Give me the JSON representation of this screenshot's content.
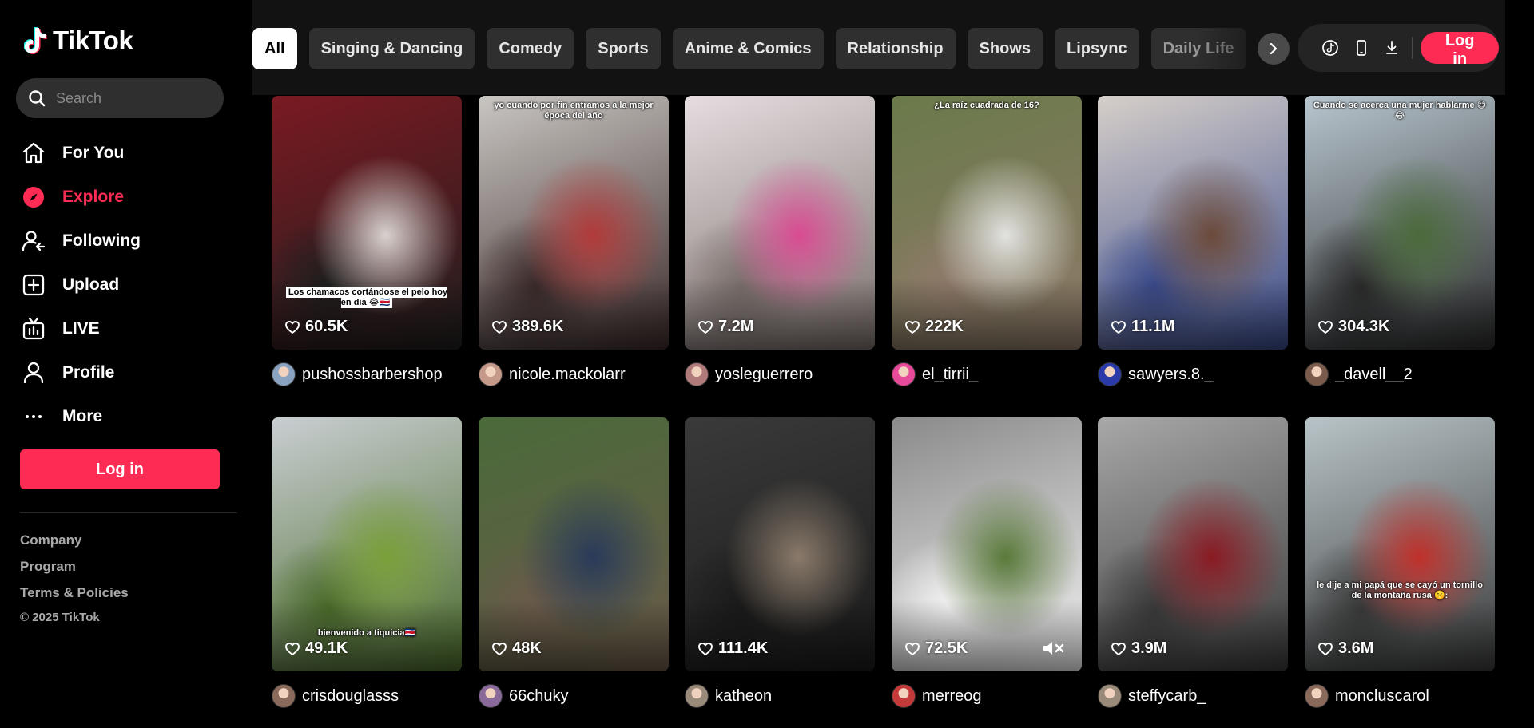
{
  "brand": {
    "name": "TikTok",
    "accent": "#fe2c55"
  },
  "search": {
    "placeholder": "Search"
  },
  "nav": [
    {
      "label": "For You",
      "icon": "home-icon",
      "active": false
    },
    {
      "label": "Explore",
      "icon": "compass-icon",
      "active": true
    },
    {
      "label": "Following",
      "icon": "following-icon",
      "active": false
    },
    {
      "label": "Upload",
      "icon": "upload-icon",
      "active": false
    },
    {
      "label": "LIVE",
      "icon": "live-tv-icon",
      "active": false
    },
    {
      "label": "Profile",
      "icon": "profile-icon",
      "active": false
    },
    {
      "label": "More",
      "icon": "more-dots-icon",
      "active": false
    }
  ],
  "sidebar_login": "Log in",
  "footer": {
    "links": [
      "Company",
      "Program",
      "Terms & Policies"
    ],
    "copyright": "© 2025 TikTok"
  },
  "categories": [
    {
      "label": "All",
      "active": true
    },
    {
      "label": "Singing & Dancing"
    },
    {
      "label": "Comedy"
    },
    {
      "label": "Sports"
    },
    {
      "label": "Anime & Comics"
    },
    {
      "label": "Relationship"
    },
    {
      "label": "Shows"
    },
    {
      "label": "Lipsync"
    },
    {
      "label": "Daily Life"
    }
  ],
  "topbar": {
    "icons": [
      "tiktok-coin-icon",
      "mobile-app-icon",
      "download-icon"
    ],
    "login": "Log in"
  },
  "videos": [
    {
      "likes": "60.5K",
      "author": "pushossbarbershop",
      "overlay": "Los chamacos cortándose el pelo hoy en día 😂🇨🇷",
      "overlay_style": "boxed",
      "overlay_pos": "bottom",
      "colors": [
        "#7a1a22",
        "#d8d2cf",
        "#1e1e1e"
      ],
      "avatar": "#8aa3c0"
    },
    {
      "likes": "389.6K",
      "author": "nicole.mackolarr",
      "overlay": "yo cuando por fin entramos a la mejor época del año",
      "overlay_style": "plain",
      "overlay_pos": "top",
      "colors": [
        "#c9c6c2",
        "#b23a3a",
        "#3b2a2a"
      ],
      "avatar": "#c69a8a"
    },
    {
      "likes": "7.2M",
      "author": "yosleguerrero",
      "overlay": "",
      "colors": [
        "#e5dde0",
        "#d94b92",
        "#7a6f6b"
      ],
      "avatar": "#b07a7a"
    },
    {
      "likes": "222K",
      "author": "el_tirrii_",
      "overlay": "¿La raíz cuadrada de 16?",
      "overlay_style": "plain",
      "overlay_pos": "top",
      "colors": [
        "#6a7a4a",
        "#e2e2e0",
        "#8f7a6a"
      ],
      "avatar": "#e84a9a"
    },
    {
      "likes": "11.1M",
      "author": "sawyers.8._",
      "overlay": "",
      "colors": [
        "#d6cfc9",
        "#6b4a3a",
        "#3a4a8a"
      ],
      "avatar": "#2a3aa8"
    },
    {
      "likes": "304.3K",
      "author": "_davell__2",
      "overlay": "Cuando se acerca una mujer hablarme 😅😂",
      "overlay_style": "plain",
      "overlay_pos": "top",
      "colors": [
        "#b8c6cf",
        "#4a6a3a",
        "#2a2a2a"
      ],
      "avatar": "#7a5a4a"
    },
    {
      "likes": "49.1K",
      "author": "crisdouglasss",
      "overlay": "bienvenido a tiquicia🇨🇷",
      "overlay_style": "plain",
      "overlay_pos": "bottom",
      "colors": [
        "#c9ced2",
        "#7aa03a",
        "#4a6a2a"
      ],
      "avatar": "#8a6a5a"
    },
    {
      "likes": "48K",
      "author": "66chuky",
      "overlay": "",
      "colors": [
        "#4a6a3a",
        "#2a3a5a",
        "#6a5a4a"
      ],
      "avatar": "#8a6a9a"
    },
    {
      "likes": "111.4K",
      "author": "katheon",
      "overlay": "",
      "colors": [
        "#3a3a3a",
        "#8a7a6a",
        "#1a1a1a"
      ],
      "avatar": "#9a8a7a"
    },
    {
      "likes": "72.5K",
      "author": "merreog",
      "overlay": "",
      "muted": true,
      "colors": [
        "#8a8a8a",
        "#5a7a3a",
        "#f2f2f2"
      ],
      "avatar": "#c43a3a"
    },
    {
      "likes": "3.9M",
      "author": "steffycarb_",
      "overlay": "",
      "colors": [
        "#a8a8a8",
        "#8a1a22",
        "#3a3a3a"
      ],
      "avatar": "#9a8a7a"
    },
    {
      "likes": "3.6M",
      "author": "moncluscarol",
      "overlay": "le dije a mi papá que se cayó un tornillo de la montaña rusa 🤫:",
      "overlay_style": "plain",
      "overlay_pos": "lower",
      "colors": [
        "#b8c4c8",
        "#c0302a",
        "#3a3a3a"
      ],
      "avatar": "#8a6a5a"
    }
  ]
}
